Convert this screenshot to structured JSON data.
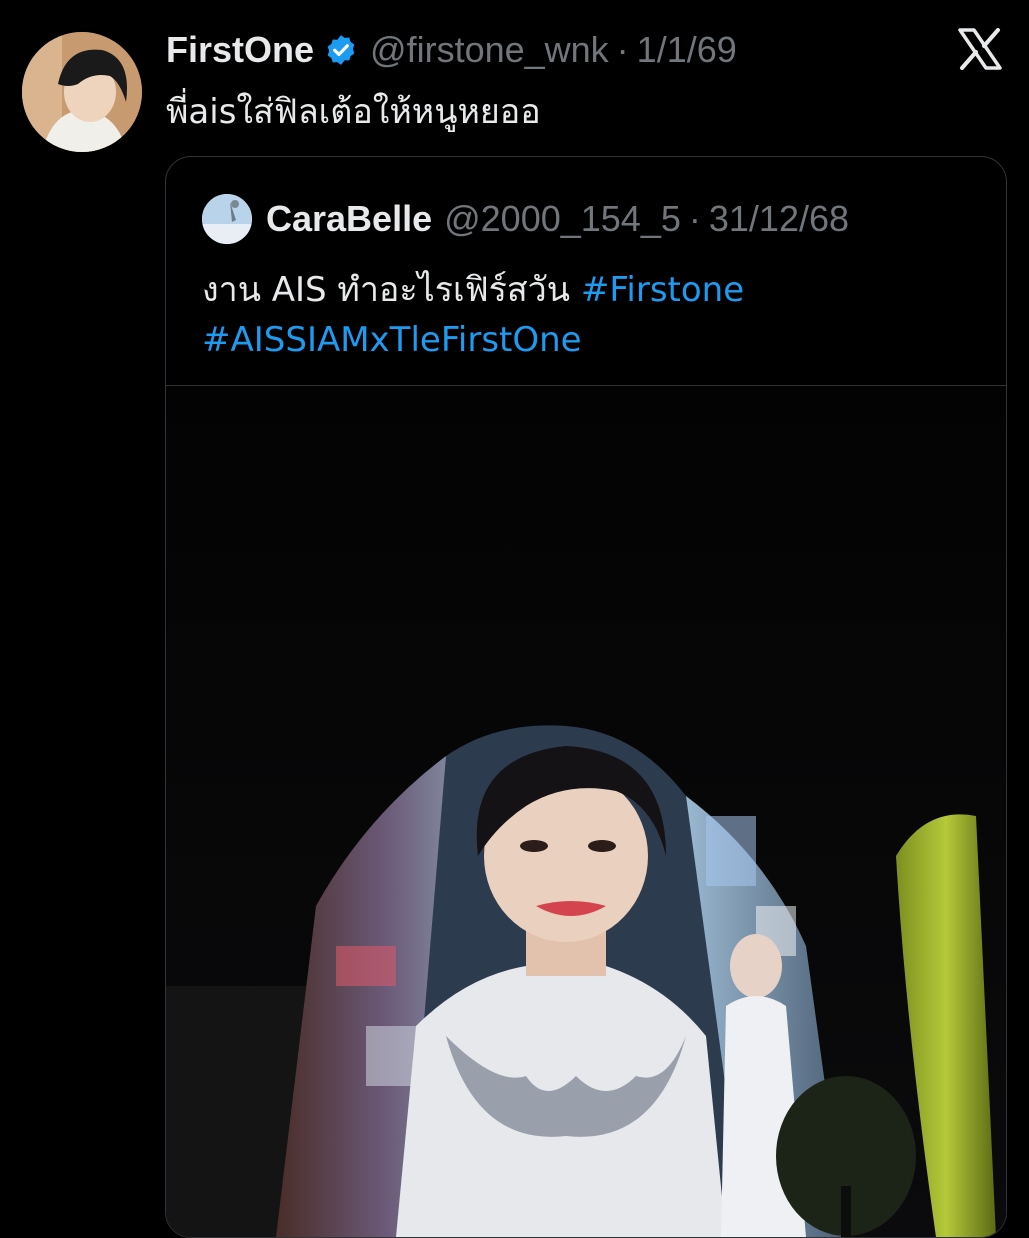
{
  "tweet": {
    "display_name": "FirstOne",
    "handle": "@firstone_wnk",
    "separator": "·",
    "date": "1/1/69",
    "text": "พี่aisใส่ฟิลเต้อให้หนูหยออ"
  },
  "quoted_tweet": {
    "display_name": "CaraBelle",
    "handle": "@2000_154_5",
    "separator": "·",
    "date": "31/12/68",
    "text_plain": "งาน AIS ทำอะไรเฟิร์สวัน ",
    "hashtags": [
      "#Firstone",
      "#AISSIAMxTleFirstOne"
    ]
  },
  "colors": {
    "background": "#000000",
    "text_primary": "#e7e9ea",
    "text_secondary": "#71767b",
    "link": "#1d9bf0",
    "verified": "#1d9bf0",
    "border": "#2f3336"
  },
  "icons": {
    "verified": "verified-badge-icon",
    "brand": "x-logo-icon"
  }
}
